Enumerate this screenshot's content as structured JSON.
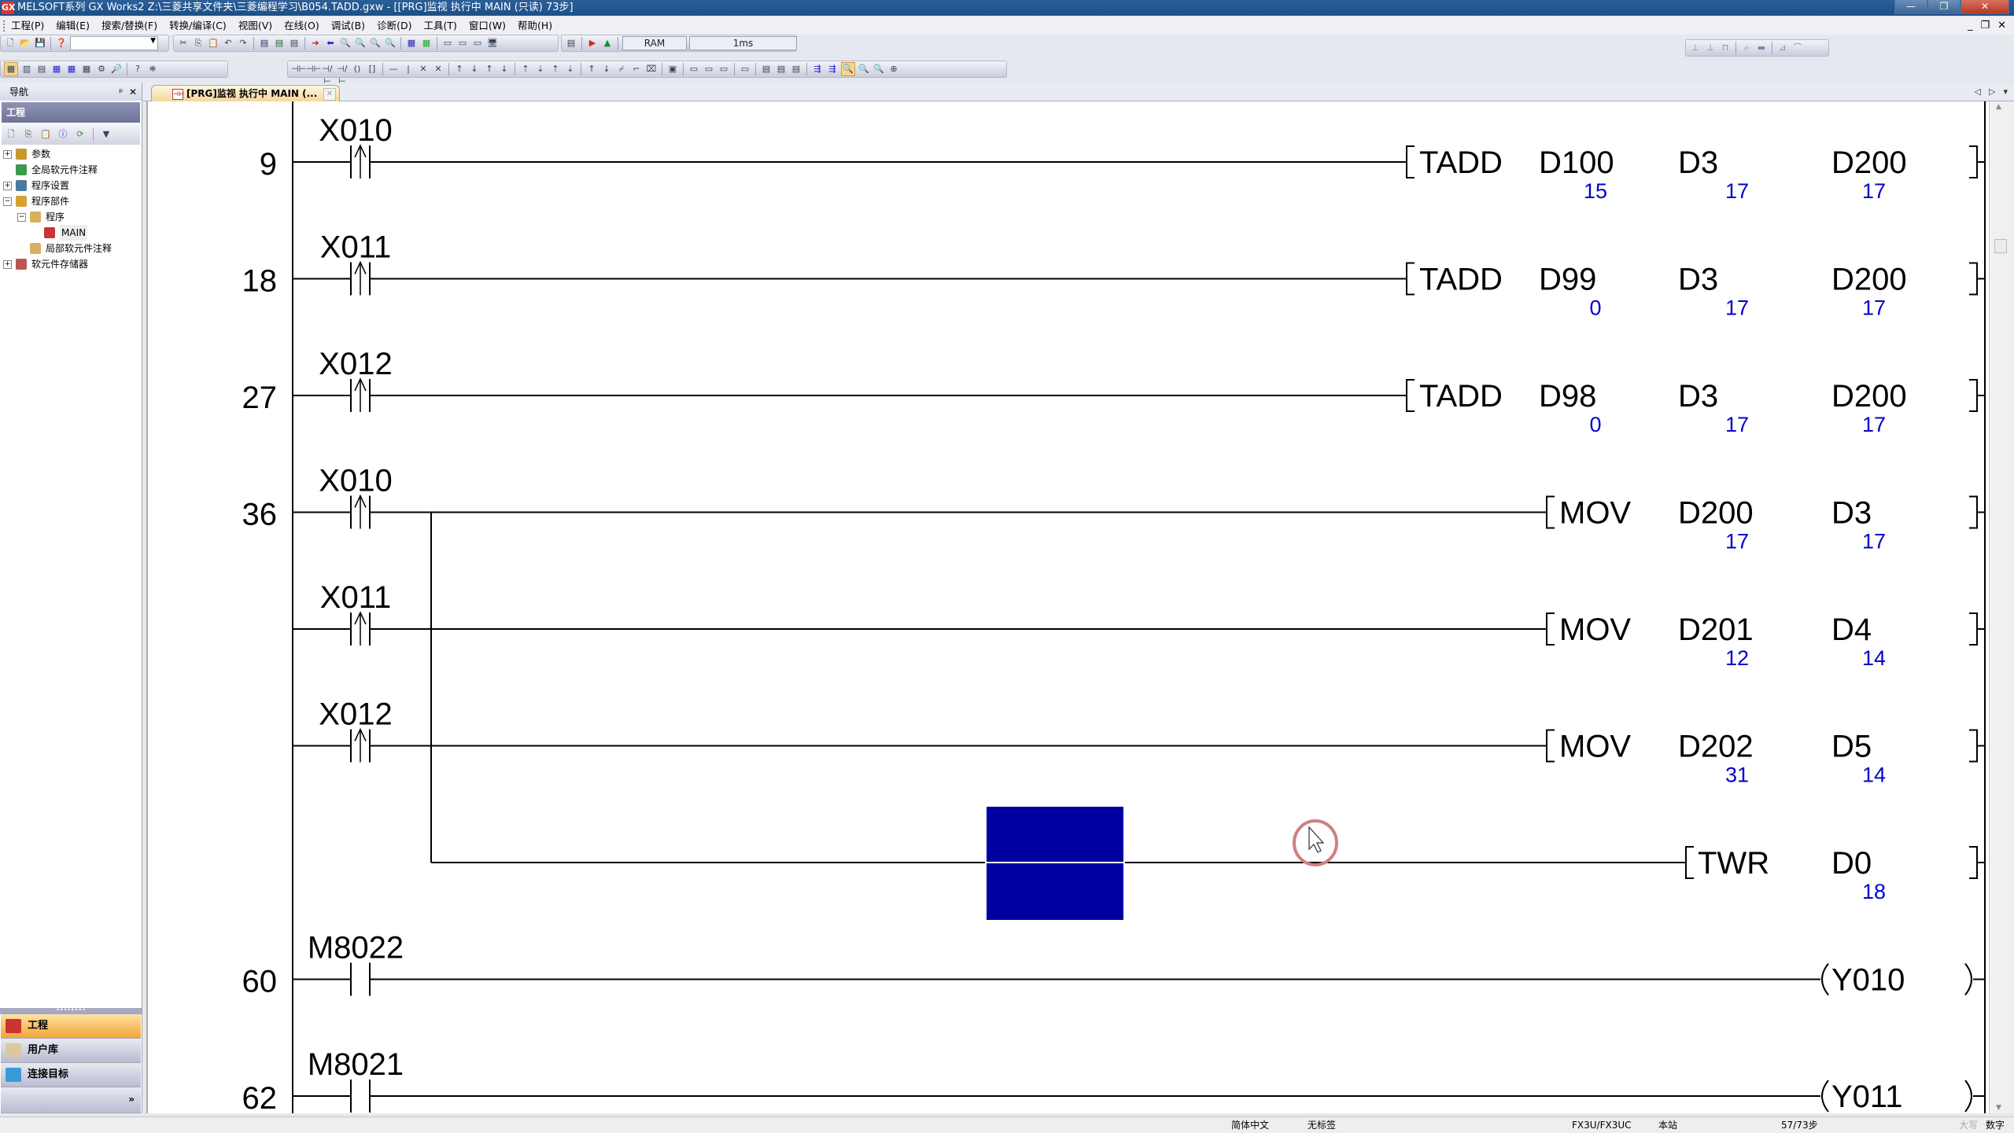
{
  "window": {
    "title": "MELSOFT系列 GX Works2 Z:\\三菱共享文件夹\\三菱编程学习\\B054.TADD.gxw - [[PRG]监视 执行中 MAIN (只读) 73步]",
    "minimize": "—",
    "restore": "❐",
    "close": "✕"
  },
  "menu": {
    "items": [
      "工程(P)",
      "编辑(E)",
      "搜索/替换(F)",
      "转换/编译(C)",
      "视图(V)",
      "在线(O)",
      "调试(B)",
      "诊断(D)",
      "工具(T)",
      "窗口(W)",
      "帮助(H)"
    ],
    "mdi_min": "_",
    "mdi_restore": "❐",
    "mdi_close": "✕"
  },
  "toolbar": {
    "combo_value": "",
    "memory_field": "RAM",
    "scan_field": "1ms"
  },
  "navigation": {
    "title": "导航",
    "pin": "ᵖ",
    "close": "✕",
    "section": "工程",
    "tree": [
      {
        "label": "参数",
        "expander": "+",
        "level": 0
      },
      {
        "label": "全局软元件注释",
        "expander": "",
        "level": 0
      },
      {
        "label": "程序设置",
        "expander": "+",
        "level": 0
      },
      {
        "label": "程序部件",
        "expander": "−",
        "level": 0
      },
      {
        "label": "程序",
        "expander": "−",
        "level": 1
      },
      {
        "label": "MAIN",
        "expander": "",
        "level": 2
      },
      {
        "label": "局部软元件注释",
        "expander": "",
        "level": 1
      },
      {
        "label": "软元件存储器",
        "expander": "+",
        "level": 0
      }
    ],
    "bottom_tabs": [
      "工程",
      "用户库",
      "连接目标"
    ],
    "more": "»"
  },
  "tabs": {
    "active": "[PRG]监视 执行中 MAIN (...",
    "close": "✕",
    "prev": "◁",
    "next": "▷",
    "menu": "▾"
  },
  "ladder": {
    "rungs": [
      {
        "step": "9",
        "contacts": [
          {
            "device": "X010",
            "type": "rising"
          }
        ],
        "instr": {
          "op": "TADD",
          "operands": [
            {
              "dev": "D100",
              "val": "15"
            },
            {
              "dev": "D3",
              "val": "17"
            },
            {
              "dev": "D200",
              "val": "17"
            }
          ]
        }
      },
      {
        "step": "18",
        "contacts": [
          {
            "device": "X011",
            "type": "rising"
          }
        ],
        "instr": {
          "op": "TADD",
          "operands": [
            {
              "dev": "D99",
              "val": "0"
            },
            {
              "dev": "D3",
              "val": "17"
            },
            {
              "dev": "D200",
              "val": "17"
            }
          ]
        }
      },
      {
        "step": "27",
        "contacts": [
          {
            "device": "X012",
            "type": "rising"
          }
        ],
        "instr": {
          "op": "TADD",
          "operands": [
            {
              "dev": "D98",
              "val": "0"
            },
            {
              "dev": "D3",
              "val": "17"
            },
            {
              "dev": "D200",
              "val": "17"
            }
          ]
        }
      },
      {
        "step": "36",
        "contacts": [
          {
            "device": "X010",
            "type": "rising"
          }
        ],
        "instr": {
          "op": "MOV",
          "operands": [
            {
              "dev": "D200",
              "val": "17"
            },
            {
              "dev": "D3",
              "val": "17"
            }
          ]
        }
      },
      {
        "step": "",
        "contacts": [
          {
            "device": "X011",
            "type": "rising"
          }
        ],
        "instr": {
          "op": "MOV",
          "operands": [
            {
              "dev": "D201",
              "val": "12"
            },
            {
              "dev": "D4",
              "val": "14"
            }
          ]
        }
      },
      {
        "step": "",
        "contacts": [
          {
            "device": "X012",
            "type": "rising"
          }
        ],
        "instr": {
          "op": "MOV",
          "operands": [
            {
              "dev": "D202",
              "val": "31"
            },
            {
              "dev": "D5",
              "val": "14"
            }
          ]
        }
      },
      {
        "step": "",
        "contacts": [],
        "instr": {
          "op": "TWR",
          "operands": [
            {
              "dev": "D0",
              "val": "18"
            }
          ]
        }
      },
      {
        "step": "60",
        "contacts": [
          {
            "device": "M8022",
            "type": "no"
          }
        ],
        "coil": "Y010"
      },
      {
        "step": "62",
        "contacts": [
          {
            "device": "M8021",
            "type": "no"
          }
        ],
        "coil": "Y011"
      }
    ],
    "cursor_color": "#0000a0",
    "value_color": "#0000cc"
  },
  "statusbar": {
    "language": "简体中文",
    "label": "无标签",
    "plc": "FX3U/FX3UC",
    "station": "本站",
    "steps": "57/73步",
    "caps": "大写",
    "num": "数字"
  }
}
